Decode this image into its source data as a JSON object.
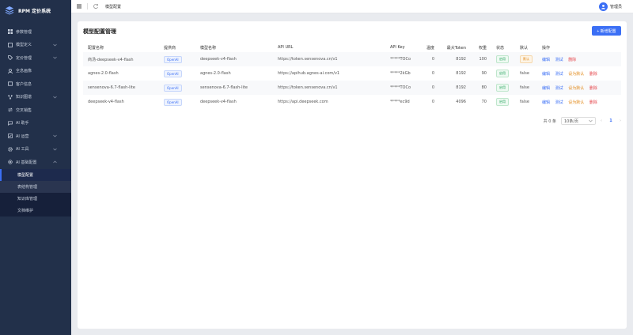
{
  "app": {
    "title": "RPM 定价系统"
  },
  "sidebar": {
    "items": [
      {
        "label": "参数管理",
        "icon": "grid-icon"
      },
      {
        "label": "模型定义",
        "icon": "box-icon"
      },
      {
        "label": "定价管理",
        "icon": "tag-icon"
      },
      {
        "label": "全息画像",
        "icon": "user-icon"
      },
      {
        "label": "客户信息",
        "icon": "contact-icon"
      },
      {
        "label": "知识图谱",
        "icon": "network-icon"
      },
      {
        "label": "交叉销售",
        "icon": "exchange-icon"
      },
      {
        "label": "AI 助手",
        "icon": "chat-icon"
      },
      {
        "label": "AI 运营",
        "icon": "checklist-icon"
      },
      {
        "label": "AI 工具",
        "icon": "gear-icon"
      },
      {
        "label": "AI 基础配置",
        "icon": "settings-icon"
      }
    ],
    "subitems": [
      "模型配置",
      "表结构管理",
      "知识库管理",
      "文档维护"
    ]
  },
  "topbar": {
    "breadcrumb": "模型配置",
    "user": "管理员"
  },
  "page": {
    "title": "模型配置管理",
    "add_label": "+ 新增配置"
  },
  "table": {
    "headers": [
      "配置名称",
      "提供商",
      "模型名称",
      "API URL",
      "API Key",
      "温度",
      "最大Token",
      "权重",
      "状态",
      "默认",
      "操作"
    ],
    "rows": [
      {
        "name": "商汤-deepseek-v4-flash",
        "provider": "OpenAI",
        "model": "deepseek-v4-flash",
        "url": "https://token.sensenova.cn/v1",
        "key": "*****TOCo",
        "temp": "0",
        "max_token": "8192",
        "weight": "100",
        "status": "启用",
        "default": "默认",
        "actions": [
          "编辑",
          "测试",
          "删除"
        ]
      },
      {
        "name": "agnes-2.0-flash",
        "provider": "OpenAI",
        "model": "agnes-2.0-flash",
        "url": "https://apihub.agnes-ai.com/v1",
        "key": "*****2kGb",
        "temp": "0",
        "max_token": "8192",
        "weight": "90",
        "status": "启用",
        "default": "false",
        "actions": [
          "编辑",
          "测试",
          "设为默认",
          "删除"
        ]
      },
      {
        "name": "sensenova-6.7-flash-lite",
        "provider": "OpenAI",
        "model": "sensenova-6.7-flash-lite",
        "url": "https://token.sensenova.cn/v1",
        "key": "*****TOCo",
        "temp": "0",
        "max_token": "8192",
        "weight": "80",
        "status": "启用",
        "default": "false",
        "actions": [
          "编辑",
          "测试",
          "设为默认",
          "删除"
        ]
      },
      {
        "name": "deepseek-v4-flash",
        "provider": "OpenAI",
        "model": "deepseek-v4-flash",
        "url": "https://api.deepseek.com",
        "key": "*****ec9d",
        "temp": "0",
        "max_token": "4096",
        "weight": "70",
        "status": "启用",
        "default": "false",
        "actions": [
          "编辑",
          "测试",
          "设为默认",
          "删除"
        ]
      }
    ]
  },
  "pagination": {
    "total": "共 0 条",
    "page_size": "10条/页",
    "current": "1"
  },
  "colors": {
    "accent": "#3b6ff5",
    "sidebar": "#22304a",
    "success": "#22a05a",
    "warning": "#e28a1a",
    "danger": "#e5484d"
  }
}
